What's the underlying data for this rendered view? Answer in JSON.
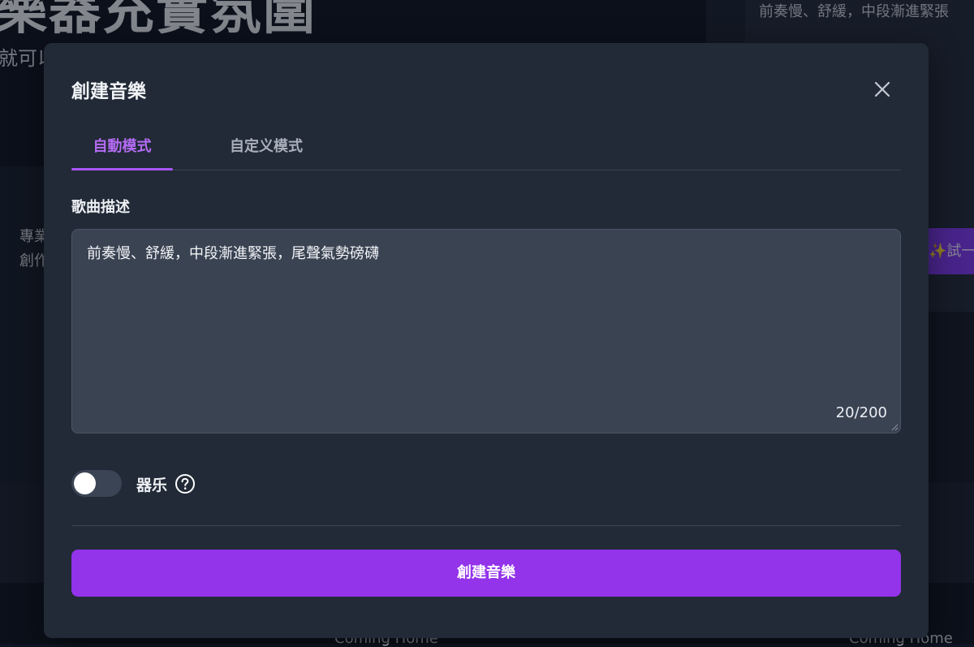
{
  "background": {
    "hero_title": "樂器充實氛圍",
    "hero_subtitle": "就可以",
    "top_right_text": "前奏慢、舒緩，中段漸進緊張",
    "feature_line1": "專業",
    "feature_line2": "創作",
    "try_button_label": "✨試一",
    "song_title_left": "Coming Home",
    "song_title_right": "Coming Home"
  },
  "modal": {
    "title": "創建音樂",
    "close_icon": "close-icon",
    "tabs": [
      {
        "label": "自動模式",
        "active": true
      },
      {
        "label": "自定义模式",
        "active": false
      }
    ],
    "description": {
      "label": "歌曲描述",
      "value": "前奏慢、舒緩，中段漸進緊張，尾聲氣勢磅礴",
      "char_count": "20/200"
    },
    "instrumental": {
      "label": "器乐",
      "enabled": false,
      "help_icon": "question-circle-icon"
    },
    "submit_label": "創建音樂"
  },
  "colors": {
    "accent": "#9333ea",
    "tab_active": "#b56cf4",
    "modal_bg": "#212a36",
    "input_bg": "#3a4352"
  }
}
